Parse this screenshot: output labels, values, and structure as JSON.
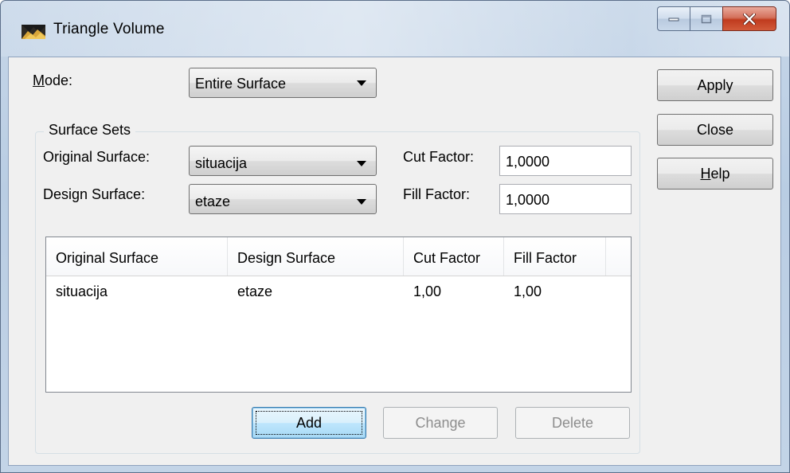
{
  "window": {
    "title": "Triangle Volume",
    "controls": {
      "minimize": "minimize",
      "maximize": "maximize",
      "close": "close"
    }
  },
  "mode": {
    "label_underlined": "M",
    "label_rest": "ode:",
    "selected": "Entire Surface"
  },
  "surface_sets": {
    "title": "Surface Sets",
    "original_label": "Original Surface:",
    "original_value": "situacija",
    "design_label": "Design Surface:",
    "design_value": "etaze",
    "cut_label": "Cut Factor:",
    "cut_value": "1,0000",
    "fill_label": "Fill Factor:",
    "fill_value": "1,0000"
  },
  "table": {
    "columns": [
      "Original Surface",
      "Design Surface",
      "Cut Factor",
      "Fill Factor"
    ],
    "rows": [
      [
        "situacija",
        "etaze",
        "1,00",
        "1,00"
      ]
    ]
  },
  "buttons": {
    "apply": "Apply",
    "close": "Close",
    "help_underlined": "H",
    "help_rest": "elp",
    "add": "Add",
    "change": "Change",
    "delete": "Delete"
  },
  "icons": {
    "app": "surface-volume-icon",
    "dropdown": "chevron-down-icon"
  }
}
